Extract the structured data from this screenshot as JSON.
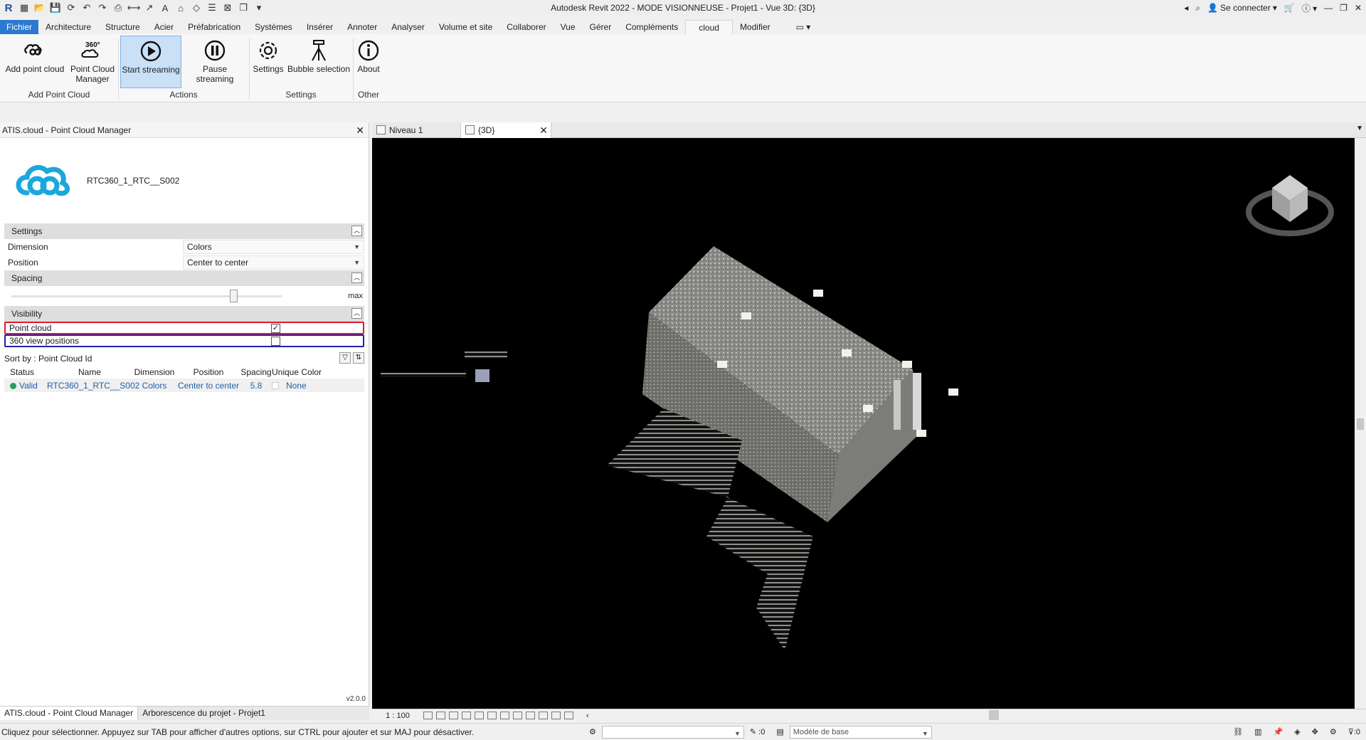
{
  "titlebar": {
    "title": "Autodesk Revit 2022 - MODE VISIONNEUSE - Projet1 - Vue 3D: {3D}",
    "signin": "Se connecter"
  },
  "menu": {
    "tabs": [
      "Fichier",
      "Architecture",
      "Structure",
      "Acier",
      "Préfabrication",
      "Systèmes",
      "Insérer",
      "Annoter",
      "Analyser",
      "Volume et site",
      "Collaborer",
      "Vue",
      "Gérer",
      "Compléments",
      "cloud",
      "Modifier"
    ],
    "active": "cloud"
  },
  "ribbon": {
    "add_point_cloud": "Add point cloud",
    "pc_manager_line1": "Point Cloud",
    "pc_manager_line2": "Manager",
    "start_streaming": "Start streaming",
    "pause_streaming": "Pause streaming",
    "settings": "Settings",
    "bubble_selection": "Bubble selection",
    "about": "About",
    "panel_add": "Add Point Cloud",
    "panel_actions": "Actions",
    "panel_settings": "Settings",
    "panel_other": "Other",
    "badge_360": "360°"
  },
  "left_panel": {
    "title": "ATIS.cloud - Point Cloud Manager",
    "cloud_name": "RTC360_1_RTC__S002",
    "settings_header": "Settings",
    "dimension_label": "Dimension",
    "dimension_value": "Colors",
    "position_label": "Position",
    "position_value": "Center to center",
    "spacing_header": "Spacing",
    "spacing_max": "max",
    "spacing_level": 0.82,
    "visibility_header": "Visibility",
    "point_cloud_label": "Point cloud",
    "view_positions_label": "360 view positions",
    "sort_by": "Sort by : Point Cloud Id",
    "columns": [
      "Status",
      "Name",
      "Dimension",
      "Position",
      "Spacing",
      "Unique Color"
    ],
    "row": {
      "status": "Valid",
      "name": "RTC360_1_RTC__S002",
      "dimension": "Colors",
      "position": "Center to center",
      "spacing": "5.8",
      "unique_color": "None"
    },
    "version": "v2.0.0"
  },
  "left_tabs": [
    "ATIS.cloud - Point Cloud Manager",
    "Arborescence du projet - Projet1"
  ],
  "view_tabs": [
    "Niveau 1",
    "{3D}"
  ],
  "view_bar": {
    "scale": "1 : 100"
  },
  "status": {
    "message": "Cliquez pour sélectionner. Appuyez sur TAB pour afficher d'autres options, sur CTRL pour ajouter et sur MAJ pour désactiver.",
    "count": ":0",
    "model": "Modèle de base",
    "filter_count": ":0"
  },
  "colors": {
    "accent": "#2b79d0",
    "selected_bg": "#c9e0f7",
    "valid": "#2a9d62",
    "highlight_red": "#e1192d",
    "highlight_blue": "#2222aa",
    "cloud_logo": "#1aa7dc"
  }
}
